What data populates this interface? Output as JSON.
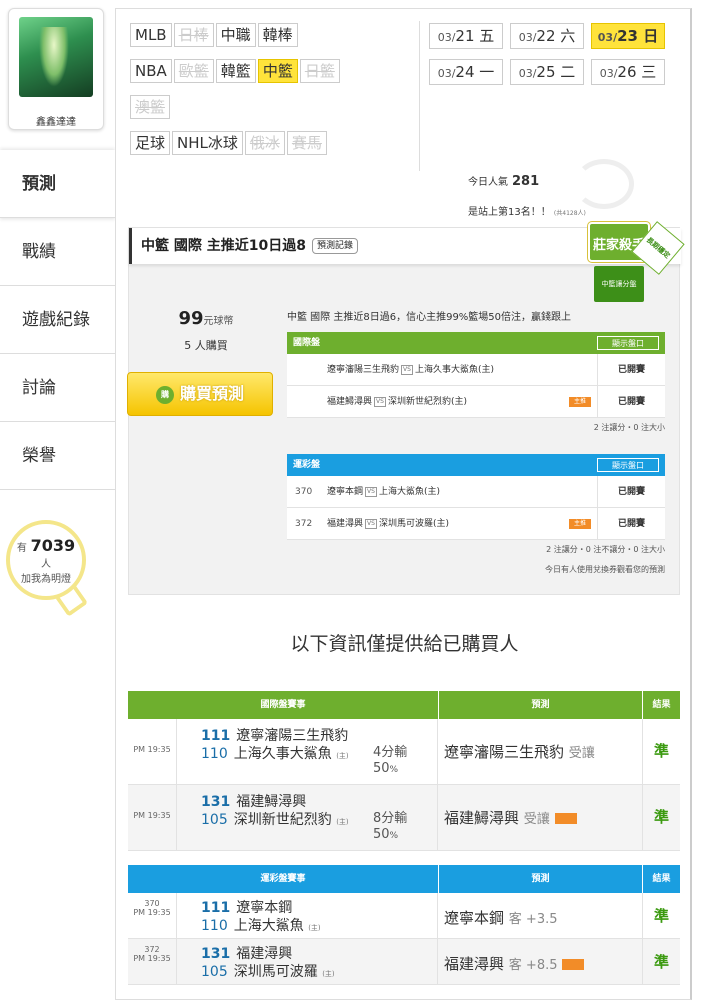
{
  "user": {
    "name": "鑫鑫達達"
  },
  "nav": [
    {
      "label": "預測"
    },
    {
      "label": "戰績"
    },
    {
      "label": "遊戲紀錄"
    },
    {
      "label": "討論"
    },
    {
      "label": "榮譽"
    }
  ],
  "fans": {
    "prefix": "有",
    "count": "7039",
    "unit": "人",
    "sub": "加我為明燈"
  },
  "filters": {
    "row1": [
      {
        "label": "MLB",
        "state": "normal"
      },
      {
        "label": "日棒",
        "state": "disabled"
      },
      {
        "label": "中職",
        "state": "normal"
      },
      {
        "label": "韓棒",
        "state": "normal"
      }
    ],
    "row2": [
      {
        "label": "NBA",
        "state": "normal"
      },
      {
        "label": "歐籃",
        "state": "disabled"
      },
      {
        "label": "韓籃",
        "state": "normal"
      },
      {
        "label": "中籃",
        "state": "active"
      },
      {
        "label": "日籃",
        "state": "disabled"
      }
    ],
    "row3": [
      {
        "label": "澳籃",
        "state": "disabled"
      }
    ],
    "row4": [
      {
        "label": "足球",
        "state": "normal"
      },
      {
        "label": "NHL冰球",
        "state": "normal"
      },
      {
        "label": "俄冰",
        "state": "disabled"
      },
      {
        "label": "賽馬",
        "state": "disabled"
      }
    ]
  },
  "dates": [
    {
      "md": "03/",
      "d": "21",
      "w": "五",
      "active": false
    },
    {
      "md": "03/",
      "d": "22",
      "w": "六",
      "active": false
    },
    {
      "md": "03/",
      "d": "23",
      "w": "日",
      "active": true
    },
    {
      "md": "03/",
      "d": "24",
      "w": "一",
      "active": false
    },
    {
      "md": "03/",
      "d": "25",
      "w": "二",
      "active": false
    },
    {
      "md": "03/",
      "d": "26",
      "w": "三",
      "active": false
    }
  ],
  "stats": {
    "today_label": "今日人氣",
    "today_value": "281",
    "rank_text": "是站上第13名！！",
    "rank_small": "(共4128人)"
  },
  "card": {
    "title": "中籃 國際 主推近10日過8",
    "record_btn": "預測記錄",
    "badge_title": "莊家殺手",
    "badge_sub": "中籃讓分盤",
    "badge_tag": "長期穩定",
    "price": "99",
    "price_unit": "元球幣",
    "buyers": "5 人購買",
    "buy_label": "購買預測",
    "buy_icon": "購",
    "summary": "中籃 國際 主推近8日過6，信心主推99%籃場50倍注，贏錢跟上",
    "intl": {
      "title": "國際盤",
      "show_btn": "顯示盤口",
      "rows": [
        {
          "num": "",
          "away": "遼寧瀋陽三生飛豹",
          "home": "上海久事大鯊魚(主)",
          "hot": false,
          "status": "已開賽"
        },
        {
          "num": "",
          "away": "福建鱘潯興",
          "home": "深圳新世紀烈豹(主)",
          "hot": true,
          "hot_label": "主推",
          "status": "已開賽"
        }
      ],
      "note": "2 注讓分・0 注大小"
    },
    "lottery": {
      "title": "運彩盤",
      "show_btn": "顯示盤口",
      "rows": [
        {
          "num": "370",
          "away": "遼寧本鋼",
          "home": "上海大鯊魚(主)",
          "hot": false,
          "status": "已開賽"
        },
        {
          "num": "372",
          "away": "福建潯興",
          "home": "深圳馬可波羅(主)",
          "hot": true,
          "hot_label": "主推",
          "status": "已開賽"
        }
      ],
      "note": "2 注讓分・0 注不讓分・0 注大小",
      "note2": "今日有人使用兌換券觀看您的預測"
    }
  },
  "info_text": "以下資訊僅提供給已購買人",
  "results_intl": {
    "headers": {
      "match": "國際盤賽事",
      "pred": "預測",
      "res": "結果"
    },
    "rows": [
      {
        "time": "PM 19:35",
        "id": "",
        "n1": "111",
        "t1": "遼寧瀋陽三生飛豹",
        "n2": "110",
        "t2": "上海久事大鯊魚",
        "home": "(主)",
        "odds1": "4分輸",
        "odds2": "50",
        "pct": "%",
        "pred_team": "遼寧瀋陽三生飛豹",
        "pred_note": "受讓",
        "pred_hot": false,
        "result": "準"
      },
      {
        "time": "PM 19:35",
        "id": "",
        "n1": "131",
        "t1": "福建鱘潯興",
        "n2": "105",
        "t2": "深圳新世紀烈豹",
        "home": "(主)",
        "odds1": "8分輸",
        "odds2": "50",
        "pct": "%",
        "pred_team": "福建鱘潯興",
        "pred_note": "受讓",
        "pred_hot": true,
        "result": "準"
      }
    ]
  },
  "results_lottery": {
    "headers": {
      "match": "運彩盤賽事",
      "pred": "預測",
      "res": "結果"
    },
    "rows": [
      {
        "time": "PM 19:35",
        "id": "370",
        "n1": "111",
        "t1": "遼寧本鋼",
        "n2": "110",
        "t2": "上海大鯊魚",
        "home": "(主)",
        "pred_team": "遼寧本鋼",
        "pred_note": "客 +3.5",
        "pred_hot": false,
        "result": "準"
      },
      {
        "time": "PM 19:35",
        "id": "372",
        "n1": "131",
        "t1": "福建潯興",
        "n2": "105",
        "t2": "深圳馬可波羅",
        "home": "(主)",
        "pred_team": "福建潯興",
        "pred_note": "客 +8.5",
        "pred_hot": true,
        "result": "準"
      }
    ]
  },
  "colors": {
    "accent_yellow": "#ffe33b",
    "green": "#6eaf2e",
    "blue": "#1a9ee0",
    "result_green": "#3b9a10"
  }
}
